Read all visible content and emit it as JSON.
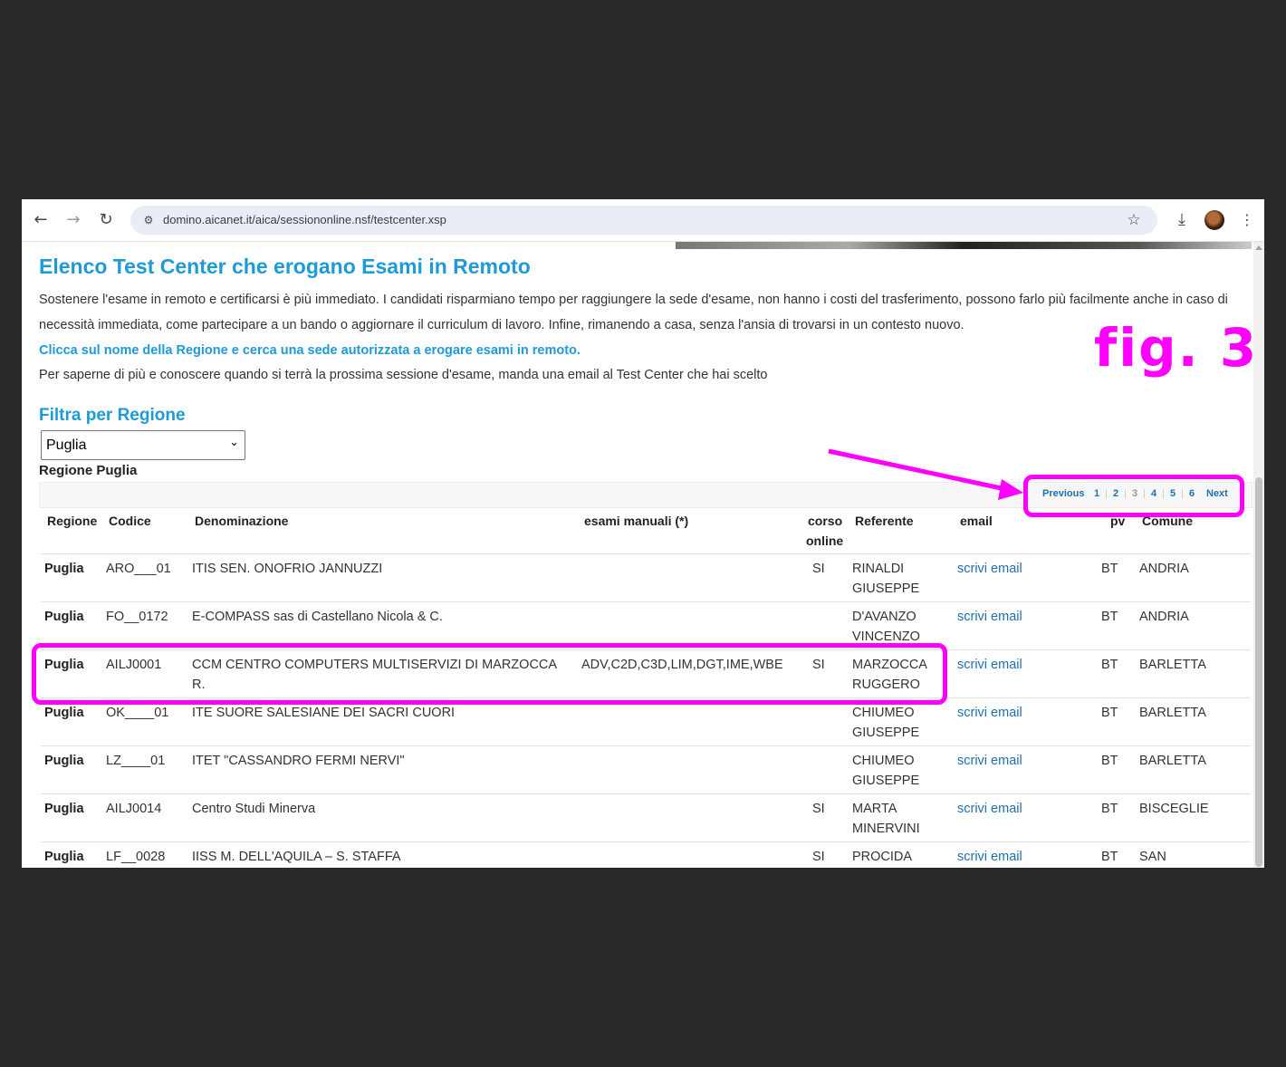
{
  "browser": {
    "url": "domino.aicanet.it/aica/sessiononline.nsf/testcenter.xsp"
  },
  "page": {
    "title": "Elenco Test Center che erogano Esami in Remoto",
    "intro_line1": "Sostenere l'esame in remoto e certificarsi è più immediato. I candidati risparmiano tempo per raggiungere la sede d'esame, non hanno i costi del trasferimento, possono farlo più facilmente anche in caso di",
    "intro_line2": "necessità immediata, come partecipare a un bando o aggiornare il curriculum di lavoro. Infine, rimanendo a casa, senza l'ansia di trovarsi in un contesto nuovo.",
    "intro_link": "Clicca sul nome della Regione e cerca una sede autorizzata a erogare esami in remoto.",
    "intro_line3": "Per saperne di più e conoscere quando si terrà la prossima sessione d'esame, manda una email al Test Center che hai scelto",
    "filter_title": "Filtra per Regione",
    "filter_value": "Puglia",
    "region_label": "Regione Puglia"
  },
  "pager": {
    "previous": "Previous",
    "pages": [
      "1",
      "2",
      "3",
      "4",
      "5",
      "6"
    ],
    "current": "3",
    "next": "Next"
  },
  "table": {
    "headers": {
      "regione": "Regione",
      "codice": "Codice",
      "denominazione": "Denominazione",
      "esami": "esami manuali (*)",
      "corso1": "corso",
      "corso2": "online",
      "referente": "Referente",
      "email": "email",
      "pv": "pv",
      "comune": "Comune"
    },
    "rows": [
      {
        "regione": "Puglia",
        "codice": "ARO___01",
        "den1": "ITIS SEN. ONOFRIO JANNUZZI",
        "den2": "",
        "esami": "",
        "corso": "SI",
        "ref1": "RINALDI",
        "ref2": "GIUSEPPE",
        "email": "scrivi email",
        "pv": "BT",
        "comune": "ANDRIA"
      },
      {
        "regione": "Puglia",
        "codice": "FO__0172",
        "den1": "E-COMPASS sas di Castellano Nicola & C.",
        "den2": "",
        "esami": "",
        "corso": "",
        "ref1": "D'AVANZO",
        "ref2": "VINCENZO",
        "email": "scrivi email",
        "pv": "BT",
        "comune": "ANDRIA"
      },
      {
        "regione": "Puglia",
        "codice": "AILJ0001",
        "den1": "CCM CENTRO COMPUTERS MULTISERVIZI DI MARZOCCA",
        "den2": "R.",
        "esami": "ADV,C2D,C3D,LIM,DGT,IME,WBE",
        "corso": "SI",
        "ref1": "MARZOCCA",
        "ref2": "RUGGERO",
        "email": "scrivi email",
        "pv": "BT",
        "comune": "BARLETTA"
      },
      {
        "regione": "Puglia",
        "codice": "OK____01",
        "den1": "ITE SUORE SALESIANE DEI SACRI CUORI",
        "den2": "",
        "esami": "",
        "corso": "",
        "ref1": "CHIUMEO",
        "ref2": "GIUSEPPE",
        "email": "scrivi email",
        "pv": "BT",
        "comune": "BARLETTA"
      },
      {
        "regione": "Puglia",
        "codice": "LZ____01",
        "den1": "ITET \"CASSANDRO FERMI NERVI\"",
        "den2": "",
        "esami": "",
        "corso": "",
        "ref1": "CHIUMEO",
        "ref2": "GIUSEPPE",
        "email": "scrivi email",
        "pv": "BT",
        "comune": "BARLETTA"
      },
      {
        "regione": "Puglia",
        "codice": "AILJ0014",
        "den1": "Centro Studi Minerva",
        "den2": "",
        "esami": "",
        "corso": "SI",
        "ref1": "MARTA",
        "ref2": "MINERVINI",
        "email": "scrivi email",
        "pv": "BT",
        "comune": "BISCEGLIE"
      },
      {
        "regione": "Puglia",
        "codice": "LF__0028",
        "den1": "IISS M. DELL'AQUILA – S. STAFFA",
        "den2": "",
        "esami": "",
        "corso": "SI",
        "ref1": "PROCIDA",
        "ref2": "",
        "email": "scrivi email",
        "pv": "BT",
        "comune": "SAN"
      }
    ]
  },
  "annotation": {
    "label": "fig. 3",
    "color": "#ff00ff"
  },
  "colors": {
    "title_blue": "#1e9ad6",
    "link_blue": "#1e6fb0",
    "backdrop": "#292929"
  }
}
